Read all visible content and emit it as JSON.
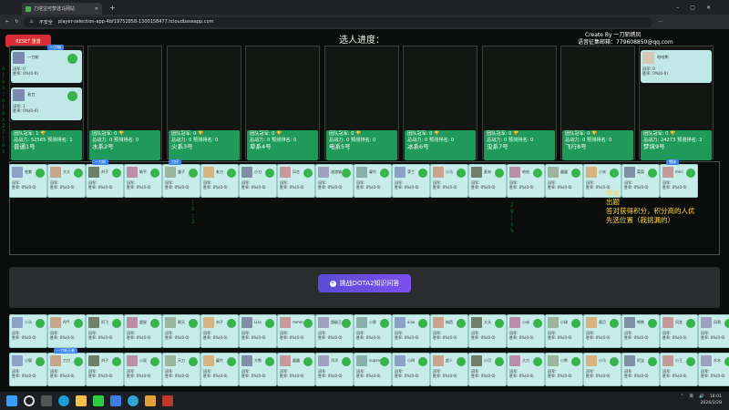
{
  "browser": {
    "tab_title": "刀塔宝可梦选马网站",
    "security_label": "不安全",
    "url": "player-selection-app-4bf19752858-1300158477.tcloudbaseapp.com"
  },
  "header": {
    "reset_label": "RESET 重置",
    "title": "选人进度：",
    "credit_line1": "Create By 一刀斩绣凤",
    "credit_line2": "语音征集邮箱：779608850@qq.com"
  },
  "teams": [
    {
      "champion": "团队冠军: 1 🏆",
      "power": "总战力: 52565 预测排名: 1",
      "name": "普通1号"
    },
    {
      "champion": "团队冠军: 0 🏆",
      "power": "总战力: 0 预测排名: 0",
      "name": "水系2号"
    },
    {
      "champion": "团队冠军: 0 🏆",
      "power": "总战力: 0 预测排名: 0",
      "name": "火系3号"
    },
    {
      "champion": "团队冠军: 0 🏆",
      "power": "总战力: 0 预测排名: 0",
      "name": "草系4号"
    },
    {
      "champion": "团队冠军: 0 🏆",
      "power": "总战力: 0 预测排名: 0",
      "name": "电系5号"
    },
    {
      "champion": "团队冠军: 0 🏆",
      "power": "总战力: 0 预测排名: 0",
      "name": "冰系6号"
    },
    {
      "champion": "团队冠军: 0 🏆",
      "power": "总战力: 0 预测排名: 0",
      "name": "虫系7号"
    },
    {
      "champion": "团队冠军: 0 🏆",
      "power": "总战力: 0 预测排名: 0",
      "name": "飞行8号"
    },
    {
      "champion": "团队冠军: 0 🏆",
      "power": "总战力: 24273 预测排名: 2",
      "name": "梦境9号"
    }
  ],
  "team1_members": [
    {
      "badge": "一刀斩",
      "name": "一刀斩",
      "s1": "冠军: 0",
      "s2": "胜率: 0%(0-0)"
    },
    {
      "badge": "",
      "name": "老刀",
      "s1": "冠军: 1",
      "s2": "胜率: 0%(0-0)"
    }
  ],
  "team9_member": {
    "name": "哈哈熊",
    "s1": "冠军: 0",
    "s2": "胜率: 0%(0-0)"
  },
  "pool_labels": {
    "stat1": "冠军:",
    "stat2": "胜率: 0%(0-0)"
  },
  "pool_row1": [
    "苍紫",
    "大大",
    "刘子",
    "皓平",
    "盒子",
    "老刀",
    "小刀",
    "风言",
    "渣渣猫",
    "蔓竹",
    "菲兰",
    "小马",
    "麦米",
    "哈哈",
    "露露",
    "小米",
    "菜菜",
    "mini"
  ],
  "pool_row1_badges": [
    "",
    "",
    "一刀斩",
    "",
    "刀仔",
    "",
    "",
    "",
    "",
    "",
    "",
    "",
    "",
    "",
    "",
    "",
    "",
    "雪球"
  ],
  "pool_row2": [
    "小马",
    "AYY",
    "阿飞",
    "超星",
    "朝天",
    "刘子",
    "Lisa",
    "mmm",
    "超级王者",
    "小胖",
    "xiao",
    "纳西",
    "大头",
    "小米",
    "小球",
    "奥月",
    "熊熊",
    "风女",
    "风哥",
    "阿云",
    "小四",
    "大力",
    "小马",
    "乔伊"
  ],
  "pool_row3": [
    "小猫",
    "刀刀",
    "刘子",
    "小双",
    "天刀",
    "蔓竹",
    "大熊",
    "露露",
    "洋洋",
    "superman",
    "小四",
    "超人",
    "小可",
    "大刀",
    "小熊",
    "小马",
    "阿宝",
    "小王",
    "木木",
    "冰冰",
    "小车",
    "天天",
    "小木",
    "超级"
  ],
  "pool_row3_badges": [
    "",
    "一刀斩王者",
    "",
    "",
    "",
    "",
    "",
    "",
    "",
    "",
    "",
    "",
    "",
    "",
    "",
    "",
    "",
    "",
    "",
    "",
    "",
    "",
    "",
    ""
  ],
  "rule_text": "水友\n出题\n答对获得积分，积分高的人优\n先选位置（我挑漏的）",
  "quiz_button": "挑战DOTA2知识问答",
  "taskbar": {
    "lang": "英",
    "time": "18:01",
    "date": "2026/3/28"
  },
  "colors": {
    "team_card": "#1f9a5a",
    "player_card": "#c7ecea",
    "accent": "#7c4ff0",
    "reset": "#d92d3a"
  }
}
